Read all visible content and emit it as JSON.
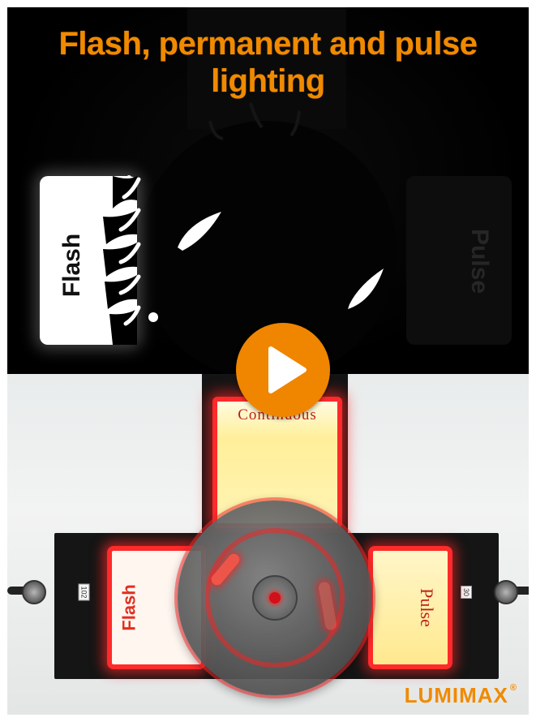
{
  "video": {
    "title": "Flash, permanent and pulse lighting",
    "play_icon": "play-icon"
  },
  "scene_top": {
    "flash_label": "Flash",
    "pulse_label": "Pulse"
  },
  "scene_bottom": {
    "continuous_label": "Continuous",
    "flash_label": "Flash",
    "pulse_label": "Pulse",
    "tag_left": "102",
    "tag_right": "30"
  },
  "brand": {
    "name": "LUMIMAX",
    "mark": "®"
  },
  "colors": {
    "accent": "#f08a00",
    "led_red": "#ff2a2a",
    "background_dark": "#000000"
  }
}
